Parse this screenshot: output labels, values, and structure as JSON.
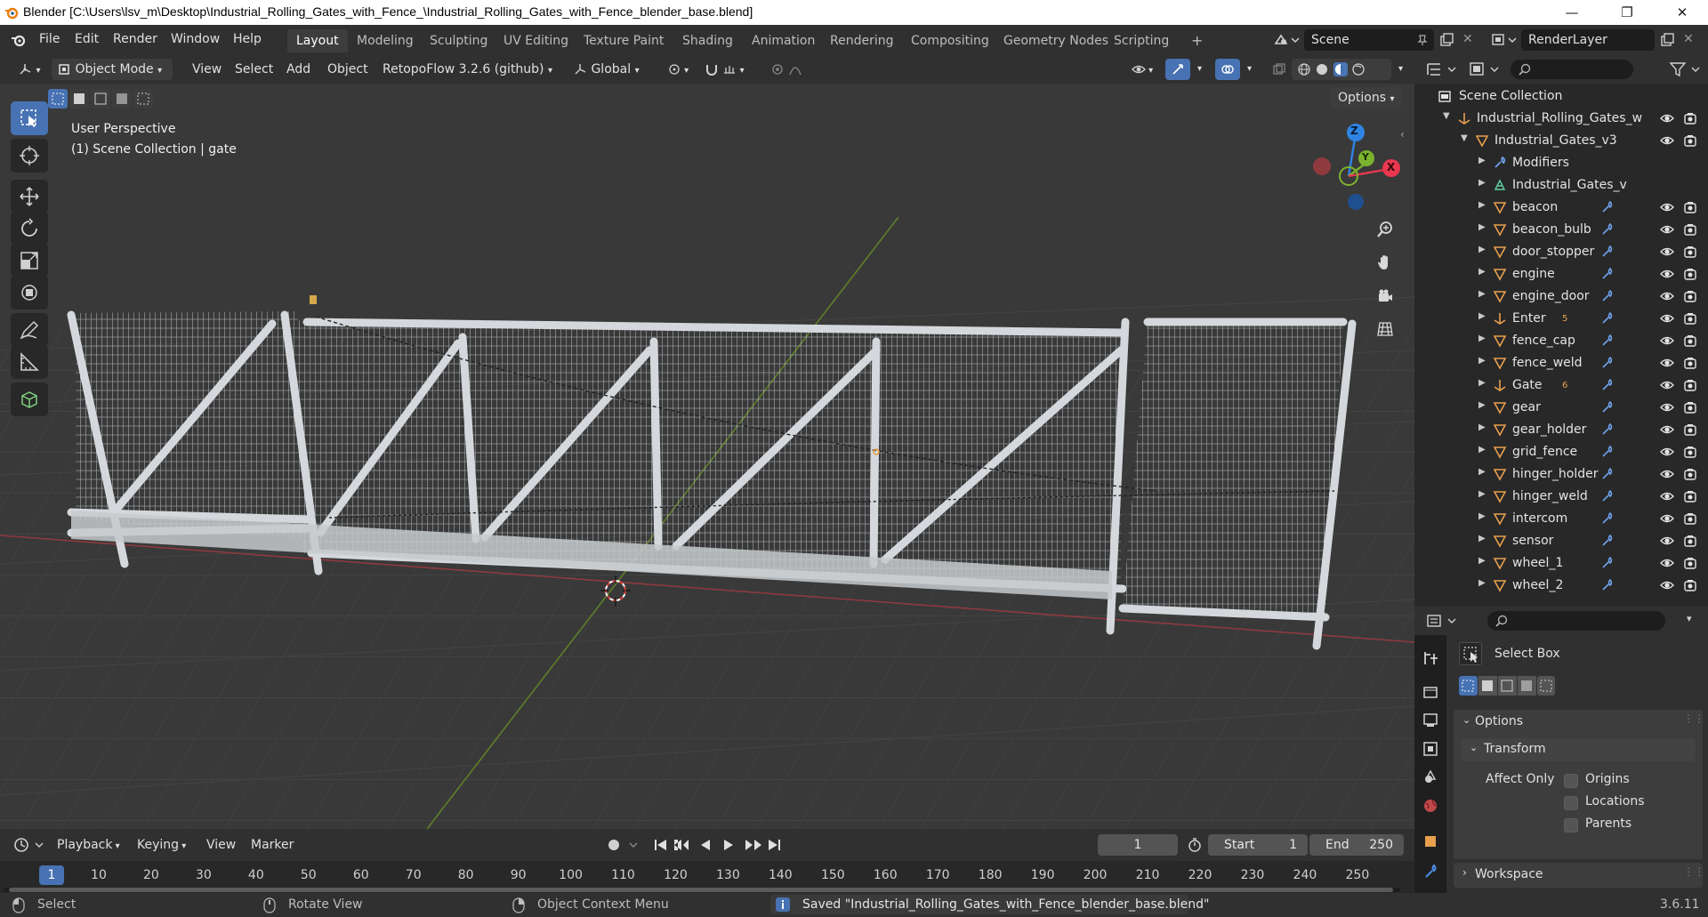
{
  "window": {
    "title": "Blender [C:\\Users\\lsv_m\\Desktop\\Industrial_Rolling_Gates_with_Fence_\\Industrial_Rolling_Gates_with_Fence_blender_base.blend]",
    "minimize": "—",
    "maximize": "❐",
    "close": "✕"
  },
  "menu": [
    "File",
    "Edit",
    "Render",
    "Window",
    "Help"
  ],
  "workspaces": [
    "Layout",
    "Modeling",
    "Sculpting",
    "UV Editing",
    "Texture Paint",
    "Shading",
    "Animation",
    "Rendering",
    "Compositing",
    "Geometry Nodes",
    "Scripting"
  ],
  "workspace_add": "+",
  "scene_name": "Scene",
  "view_layer": "RenderLayer",
  "viewport_header": {
    "mode": "Object Mode",
    "menus": [
      "View",
      "Select",
      "Add",
      "Object"
    ],
    "addon": "RetopoFlow 3.2.6 (github)",
    "orientation": "Global",
    "options": "Options"
  },
  "viewport": {
    "perspective": "User Perspective",
    "collection_info": "(1) Scene Collection | gate",
    "gizmo": {
      "z": "Z",
      "y": "Y",
      "x": "X"
    }
  },
  "outliner": {
    "root": "Scene Collection",
    "items": [
      {
        "label": "Industrial_Rolling_Gates_w",
        "depth": 0
      },
      {
        "label": "Industrial_Gates_v3",
        "depth": 1
      },
      {
        "label": "Modifiers",
        "depth": 2
      },
      {
        "label": "Industrial_Gates_v",
        "depth": 2
      },
      {
        "label": "beacon",
        "depth": 2
      },
      {
        "label": "beacon_bulb",
        "depth": 2
      },
      {
        "label": "door_stopper",
        "depth": 2
      },
      {
        "label": "engine",
        "depth": 2
      },
      {
        "label": "engine_door",
        "depth": 2
      },
      {
        "label": "Enter",
        "depth": 2,
        "badge": "5"
      },
      {
        "label": "fence_cap",
        "depth": 2
      },
      {
        "label": "fence_weld",
        "depth": 2
      },
      {
        "label": "Gate",
        "depth": 2,
        "badge": "6"
      },
      {
        "label": "gear",
        "depth": 2
      },
      {
        "label": "gear_holder",
        "depth": 2
      },
      {
        "label": "grid_fence",
        "depth": 2
      },
      {
        "label": "hinger_holder",
        "depth": 2
      },
      {
        "label": "hinger_weld",
        "depth": 2
      },
      {
        "label": "intercom",
        "depth": 2
      },
      {
        "label": "sensor",
        "depth": 2
      },
      {
        "label": "wheel_1",
        "depth": 2
      },
      {
        "label": "wheel_2",
        "depth": 2
      }
    ]
  },
  "properties": {
    "tool_name": "Select Box",
    "options_label": "Options",
    "transform_label": "Transform",
    "affect_only": "Affect Only",
    "checks": [
      "Origins",
      "Locations",
      "Parents"
    ],
    "workspace_label": "Workspace"
  },
  "timeline": {
    "menus": [
      "Playback",
      "Keying",
      "View",
      "Marker"
    ],
    "current_frame": "1",
    "start_label": "Start",
    "start": "1",
    "end_label": "End",
    "end": "250",
    "ticks": [
      "1",
      "10",
      "20",
      "30",
      "40",
      "50",
      "60",
      "70",
      "80",
      "90",
      "100",
      "110",
      "120",
      "130",
      "140",
      "150",
      "160",
      "170",
      "180",
      "190",
      "200",
      "210",
      "220",
      "230",
      "240",
      "250"
    ]
  },
  "statusbar": {
    "select": "Select",
    "rotate": "Rotate View",
    "context": "Object Context Menu",
    "message": "Saved \"Industrial_Rolling_Gates_with_Fence_blender_base.blend\"",
    "version": "3.6.11"
  },
  "colors": {
    "accent": "#4772b3",
    "x_axis": "#e8374f",
    "y_axis": "#7bb32e",
    "z_axis": "#2f84e3",
    "object_icon": "#e89f4e"
  }
}
